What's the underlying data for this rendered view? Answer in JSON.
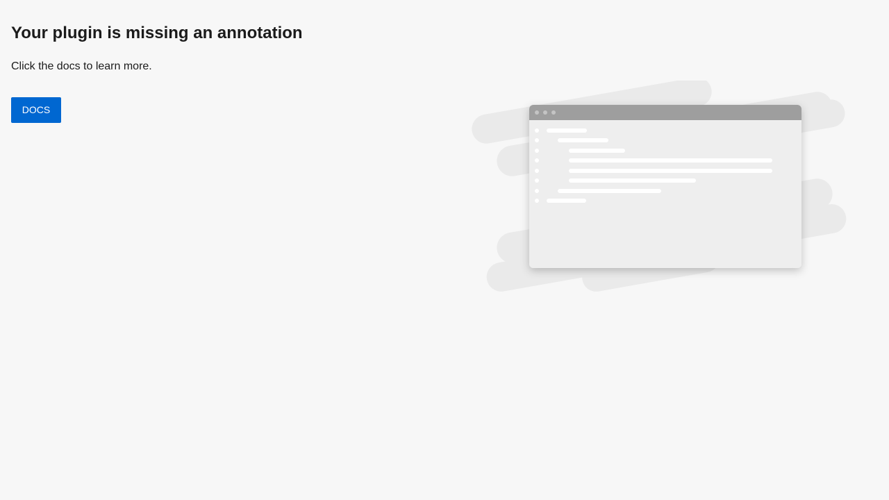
{
  "page": {
    "title": "Your plugin is missing an annotation",
    "subtitle": "Click the docs to learn more.",
    "docs_button_label": "DOCS"
  },
  "colors": {
    "background": "#f7f7f7",
    "accent": "#0067d1",
    "window_titlebar": "#9e9e9e",
    "window_body": "#eeeeee",
    "background_strokes": "#eaeaea"
  },
  "illustration": {
    "icon": "browser-window-illustration",
    "code_line_count": 8
  }
}
